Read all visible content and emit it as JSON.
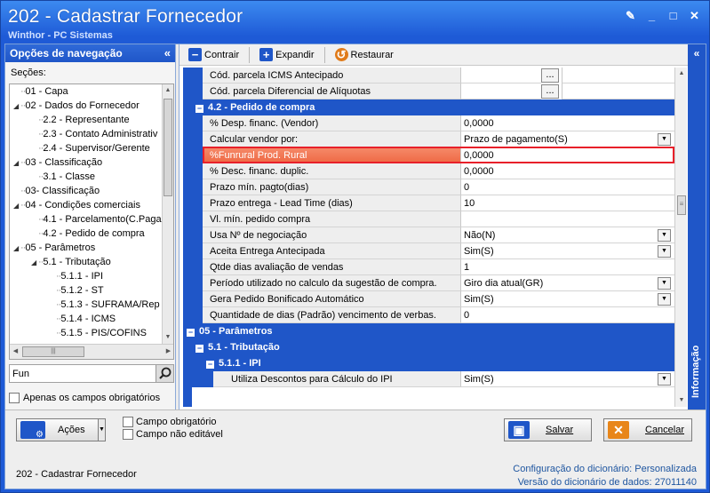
{
  "window": {
    "title": "202 - Cadastrar  Fornecedor",
    "subtitle": "Winthor - PC Sistemas"
  },
  "nav": {
    "header": "Opções de navegação",
    "sections_label": "Seções:",
    "tree": [
      {
        "label": "01 - Capa",
        "indent": 0,
        "toggle": ""
      },
      {
        "label": "02 - Dados do Fornecedor",
        "indent": 0,
        "toggle": "◢"
      },
      {
        "label": "2.2 - Representante",
        "indent": 1,
        "toggle": ""
      },
      {
        "label": "2.3 - Contato Administrativ",
        "indent": 1,
        "toggle": ""
      },
      {
        "label": "2.4 - Supervisor/Gerente",
        "indent": 1,
        "toggle": ""
      },
      {
        "label": "03 - Classificação",
        "indent": 0,
        "toggle": "◢"
      },
      {
        "label": "3.1 - Classe",
        "indent": 1,
        "toggle": ""
      },
      {
        "label": "03- Classificação",
        "indent": 0,
        "toggle": ""
      },
      {
        "label": "04 - Condições comerciais",
        "indent": 0,
        "toggle": "◢"
      },
      {
        "label": "4.1 - Parcelamento(C.Paga",
        "indent": 1,
        "toggle": ""
      },
      {
        "label": "4.2 - Pedido de compra",
        "indent": 1,
        "toggle": ""
      },
      {
        "label": "05 - Parâmetros",
        "indent": 0,
        "toggle": "◢"
      },
      {
        "label": "5.1 - Tributação",
        "indent": 1,
        "toggle": "◢"
      },
      {
        "label": "5.1.1 - IPI",
        "indent": 2,
        "toggle": ""
      },
      {
        "label": "5.1.2 - ST",
        "indent": 2,
        "toggle": ""
      },
      {
        "label": "5.1.3 - SUFRAMA/Rep",
        "indent": 2,
        "toggle": ""
      },
      {
        "label": "5.1.4 - ICMS",
        "indent": 2,
        "toggle": ""
      },
      {
        "label": "5.1.5 - PIS/COFINS",
        "indent": 2,
        "toggle": ""
      }
    ],
    "filter_value": "Fun",
    "only_required_label": "Apenas os campos obrigatórios"
  },
  "toolbar": {
    "collapse_label": "Contrair",
    "expand_label": "Expandir",
    "restore_label": "Restaurar"
  },
  "grid": {
    "rows": [
      {
        "kind": "field",
        "name": "Cód. parcela ICMS Antecipado",
        "value": "",
        "control": "ellipsis"
      },
      {
        "kind": "field",
        "name": "Cód. parcela Diferencial de Alíquotas",
        "value": "",
        "control": "ellipsis"
      },
      {
        "kind": "section",
        "level": 1,
        "name": "4.2 - Pedido de compra"
      },
      {
        "kind": "field",
        "name": "% Desp. financ. (Vendor)",
        "value": "0,0000",
        "control": ""
      },
      {
        "kind": "field",
        "name": "Calcular vendor por:",
        "value": "Prazo de pagamento(S)",
        "control": "dropdown"
      },
      {
        "kind": "field",
        "name": "%Funrural Prod. Rural",
        "value": "0,0000",
        "control": "",
        "highlight": true
      },
      {
        "kind": "field",
        "name": "% Desc. financ. duplic.",
        "value": "0,0000",
        "control": ""
      },
      {
        "kind": "field",
        "name": "Prazo mín. pagto(dias)",
        "value": "0",
        "control": ""
      },
      {
        "kind": "field",
        "name": "Prazo entrega - Lead Time (dias)",
        "value": "10",
        "control": ""
      },
      {
        "kind": "field",
        "name": "Vl. mín. pedido compra",
        "value": "",
        "control": ""
      },
      {
        "kind": "field",
        "name": "Usa Nº de negociação",
        "value": "Não(N)",
        "control": "dropdown"
      },
      {
        "kind": "field",
        "name": "Aceita Entrega Antecipada",
        "value": "Sim(S)",
        "control": "dropdown"
      },
      {
        "kind": "field",
        "name": "Qtde dias avaliação de vendas",
        "value": "1",
        "control": ""
      },
      {
        "kind": "field",
        "name": "Período utilizado no calculo da sugestão de compra.",
        "value": "Giro dia atual(GR)",
        "control": "dropdown"
      },
      {
        "kind": "field",
        "name": "Gera Pedido Bonificado Automático",
        "value": "Sim(S)",
        "control": "dropdown"
      },
      {
        "kind": "field",
        "name": "Quantidade de dias (Padrão) vencimento de verbas.",
        "value": "0",
        "control": ""
      },
      {
        "kind": "section",
        "level": 0,
        "name": "05 - Parâmetros"
      },
      {
        "kind": "section",
        "level": 1,
        "name": "5.1 - Tributação"
      },
      {
        "kind": "section",
        "level": 2,
        "name": "5.1.1 - IPI"
      },
      {
        "kind": "field",
        "level": 3,
        "name": "Utiliza Descontos para Cálculo do IPI",
        "value": "Sim(S)",
        "control": "dropdown"
      }
    ]
  },
  "info_panel": {
    "label": "Informação"
  },
  "bottom": {
    "actions_label": "Ações",
    "legend_required": "Campo obrigatório",
    "legend_not_editable": "Campo não editável",
    "save_label": "Salvar",
    "cancel_label": "Cancelar",
    "status_left": "202 - Cadastrar  Fornecedor",
    "dict_config_label": "Configuração do dicionário:",
    "dict_config_value": "Personalizada",
    "dict_version_label": "Versão do dicionário de dados:",
    "dict_version_value": "27011140"
  },
  "colors": {
    "accent": "#1f56c8",
    "highlight_fill": "#ef6a45",
    "highlight_border": "#e8202a"
  }
}
